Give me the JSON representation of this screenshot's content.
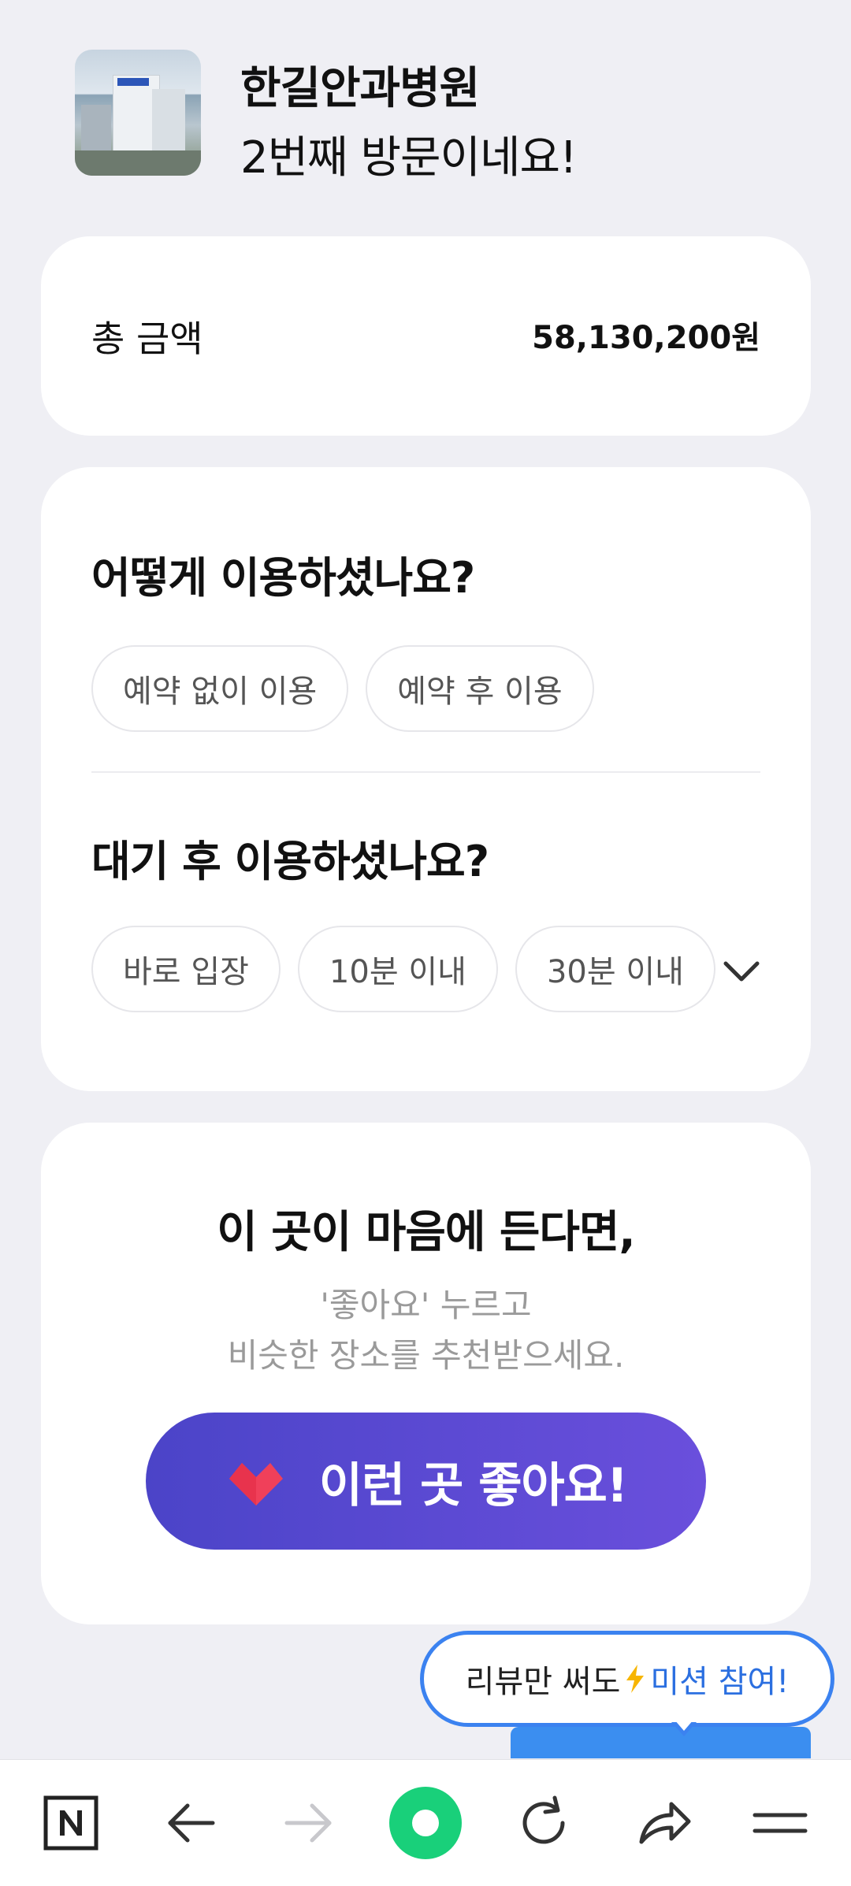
{
  "header": {
    "hospital_name": "한길안과병원",
    "visit_text": "2번째 방문이네요!"
  },
  "total": {
    "label": "총 금액",
    "value": "58,130,200원"
  },
  "survey": {
    "q1": {
      "title": "어떻게 이용하셨나요?",
      "options": [
        "예약 없이 이용",
        "예약 후 이용"
      ]
    },
    "q2": {
      "title": "대기 후 이용하셨나요?",
      "options": [
        "바로 입장",
        "10분 이내",
        "30분 이내"
      ]
    }
  },
  "like": {
    "title": "이 곳이 마음에 든다면,",
    "sub1": "'좋아요' 누르고",
    "sub2": "비슷한 장소를 추천받으세요.",
    "button_label": "이런 곳 좋아요!"
  },
  "mission": {
    "text": "리뷰만 써도",
    "cta": "미션 참여!"
  },
  "icons": {
    "heart": "heart-icon",
    "bolt": "lightning-icon",
    "chevron": "chevron-down-icon",
    "nav": [
      "naver-home-icon",
      "back-arrow-icon",
      "forward-arrow-icon",
      "green-dot-icon",
      "refresh-icon",
      "share-icon",
      "menu-icon"
    ]
  },
  "colors": {
    "accent": "#5a4ad6",
    "mission_blue": "#3b82f0",
    "green": "#03c75a"
  }
}
